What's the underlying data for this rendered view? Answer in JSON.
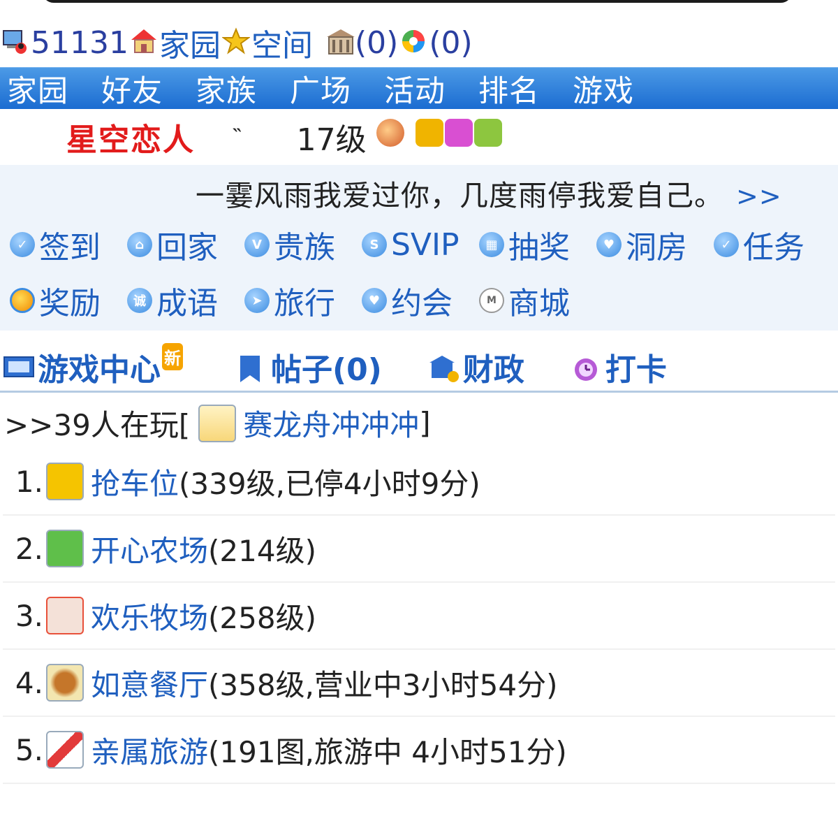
{
  "top": {
    "id": "51131",
    "home_label": "家园",
    "space_label": "空间",
    "count1": "(0)",
    "count2": "(0)"
  },
  "nav": [
    "家园",
    "好友",
    "家族",
    "广场",
    "活动",
    "排名",
    "游戏"
  ],
  "profile": {
    "name": "星空恋人",
    "mark": "˵",
    "level": "17级"
  },
  "motto": {
    "text": "一霎风雨我爱过你，几度雨停我爱自己。",
    "more": ">>"
  },
  "quick_links_row1": [
    "签到",
    "回家",
    "贵族",
    "SVIP",
    "抽奖",
    "洞房",
    "任务"
  ],
  "quick_links_row2": [
    "奖励",
    "成语",
    "旅行",
    "约会",
    "商城"
  ],
  "tabs": {
    "game_center": "游戏中心",
    "new_badge": "新",
    "posts": "帖子(0)",
    "finance": "财政",
    "checkin": "打卡"
  },
  "playing": {
    "prefix": ">>39人在玩[",
    "game": "赛龙舟冲冲冲",
    "suffix": "]"
  },
  "games": [
    {
      "num": "1.",
      "name": "抢车位",
      "detail": "(339级,已停4小时9分)",
      "icon": "car-icon",
      "color": "#f5c400"
    },
    {
      "num": "2.",
      "name": "开心农场",
      "detail": "(214级)",
      "icon": "farm-icon",
      "color": "#5fbf4a"
    },
    {
      "num": "3.",
      "name": "欢乐牧场",
      "detail": "(258级)",
      "icon": "ranch-icon",
      "color": "#e8503a"
    },
    {
      "num": "4.",
      "name": "如意餐厅",
      "detail": "(358级,营业中3小时54分)",
      "icon": "restaurant-icon",
      "color": "#c5762a"
    },
    {
      "num": "5.",
      "name": "亲属旅游",
      "detail": "(191图,旅游中 4小时51分)",
      "icon": "travel-icon",
      "color": "#e23a3a"
    }
  ]
}
